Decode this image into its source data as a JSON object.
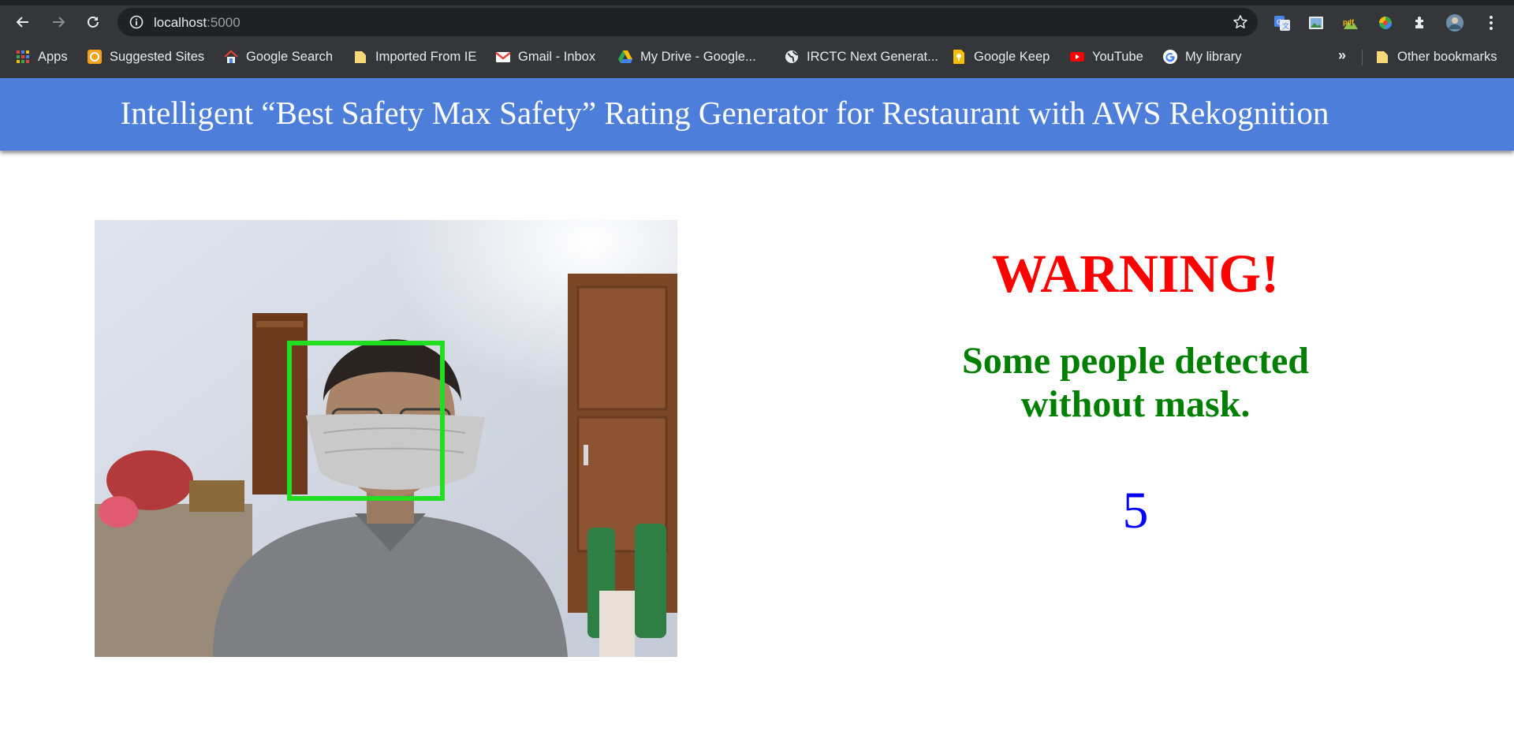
{
  "browser": {
    "url_host": "localhost",
    "url_port": ":5000",
    "bookmarks": [
      {
        "label": "Apps",
        "icon": "apps-grid-icon"
      },
      {
        "label": "Suggested Sites",
        "icon": "suggested-sites-icon"
      },
      {
        "label": "Google Search",
        "icon": "google-search-house-icon"
      },
      {
        "label": "Imported From IE",
        "icon": "folder-icon"
      },
      {
        "label": "Gmail - Inbox",
        "icon": "gmail-icon"
      },
      {
        "label": "My Drive - Google...",
        "icon": "google-drive-icon"
      },
      {
        "label": "IRCTC Next Generat...",
        "icon": "globe-icon"
      },
      {
        "label": "Google Keep",
        "icon": "google-keep-icon"
      },
      {
        "label": "YouTube",
        "icon": "youtube-icon"
      },
      {
        "label": "My library",
        "icon": "google-g-icon"
      }
    ],
    "overflow": "»",
    "other_bookmarks": "Other bookmarks"
  },
  "page": {
    "title": "Intelligent “Best Safety Max Safety” Rating Generator for Restaurant with AWS Rekognition",
    "warning": "WARNING!",
    "message": "Some people detected without mask.",
    "rating": "5"
  },
  "colors": {
    "header_bg": "#4d7ed9",
    "warning": "#ff0000",
    "message": "#008000",
    "rating": "#0000ff",
    "detection_box": "#22dd22"
  }
}
